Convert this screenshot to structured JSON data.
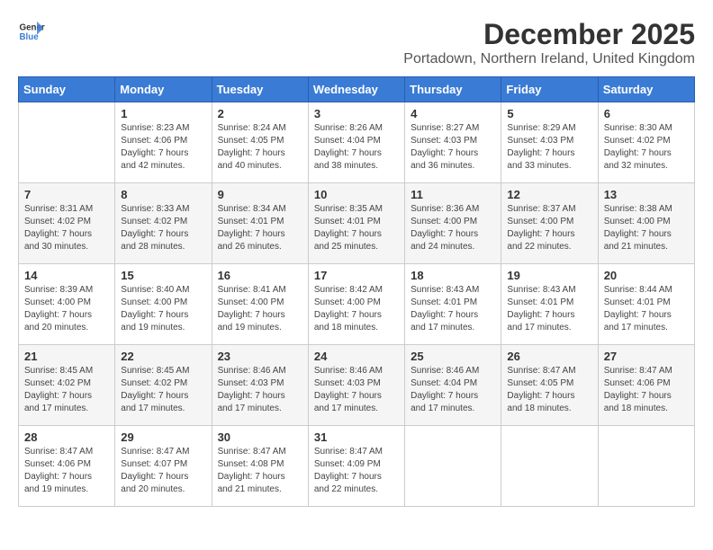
{
  "header": {
    "logo_general": "General",
    "logo_blue": "Blue",
    "month": "December 2025",
    "location": "Portadown, Northern Ireland, United Kingdom"
  },
  "days_of_week": [
    "Sunday",
    "Monday",
    "Tuesday",
    "Wednesday",
    "Thursday",
    "Friday",
    "Saturday"
  ],
  "weeks": [
    [
      {
        "day": "",
        "info": ""
      },
      {
        "day": "1",
        "info": "Sunrise: 8:23 AM\nSunset: 4:06 PM\nDaylight: 7 hours\nand 42 minutes."
      },
      {
        "day": "2",
        "info": "Sunrise: 8:24 AM\nSunset: 4:05 PM\nDaylight: 7 hours\nand 40 minutes."
      },
      {
        "day": "3",
        "info": "Sunrise: 8:26 AM\nSunset: 4:04 PM\nDaylight: 7 hours\nand 38 minutes."
      },
      {
        "day": "4",
        "info": "Sunrise: 8:27 AM\nSunset: 4:03 PM\nDaylight: 7 hours\nand 36 minutes."
      },
      {
        "day": "5",
        "info": "Sunrise: 8:29 AM\nSunset: 4:03 PM\nDaylight: 7 hours\nand 33 minutes."
      },
      {
        "day": "6",
        "info": "Sunrise: 8:30 AM\nSunset: 4:02 PM\nDaylight: 7 hours\nand 32 minutes."
      }
    ],
    [
      {
        "day": "7",
        "info": "Sunrise: 8:31 AM\nSunset: 4:02 PM\nDaylight: 7 hours\nand 30 minutes."
      },
      {
        "day": "8",
        "info": "Sunrise: 8:33 AM\nSunset: 4:02 PM\nDaylight: 7 hours\nand 28 minutes."
      },
      {
        "day": "9",
        "info": "Sunrise: 8:34 AM\nSunset: 4:01 PM\nDaylight: 7 hours\nand 26 minutes."
      },
      {
        "day": "10",
        "info": "Sunrise: 8:35 AM\nSunset: 4:01 PM\nDaylight: 7 hours\nand 25 minutes."
      },
      {
        "day": "11",
        "info": "Sunrise: 8:36 AM\nSunset: 4:00 PM\nDaylight: 7 hours\nand 24 minutes."
      },
      {
        "day": "12",
        "info": "Sunrise: 8:37 AM\nSunset: 4:00 PM\nDaylight: 7 hours\nand 22 minutes."
      },
      {
        "day": "13",
        "info": "Sunrise: 8:38 AM\nSunset: 4:00 PM\nDaylight: 7 hours\nand 21 minutes."
      }
    ],
    [
      {
        "day": "14",
        "info": "Sunrise: 8:39 AM\nSunset: 4:00 PM\nDaylight: 7 hours\nand 20 minutes."
      },
      {
        "day": "15",
        "info": "Sunrise: 8:40 AM\nSunset: 4:00 PM\nDaylight: 7 hours\nand 19 minutes."
      },
      {
        "day": "16",
        "info": "Sunrise: 8:41 AM\nSunset: 4:00 PM\nDaylight: 7 hours\nand 19 minutes."
      },
      {
        "day": "17",
        "info": "Sunrise: 8:42 AM\nSunset: 4:00 PM\nDaylight: 7 hours\nand 18 minutes."
      },
      {
        "day": "18",
        "info": "Sunrise: 8:43 AM\nSunset: 4:01 PM\nDaylight: 7 hours\nand 17 minutes."
      },
      {
        "day": "19",
        "info": "Sunrise: 8:43 AM\nSunset: 4:01 PM\nDaylight: 7 hours\nand 17 minutes."
      },
      {
        "day": "20",
        "info": "Sunrise: 8:44 AM\nSunset: 4:01 PM\nDaylight: 7 hours\nand 17 minutes."
      }
    ],
    [
      {
        "day": "21",
        "info": "Sunrise: 8:45 AM\nSunset: 4:02 PM\nDaylight: 7 hours\nand 17 minutes."
      },
      {
        "day": "22",
        "info": "Sunrise: 8:45 AM\nSunset: 4:02 PM\nDaylight: 7 hours\nand 17 minutes."
      },
      {
        "day": "23",
        "info": "Sunrise: 8:46 AM\nSunset: 4:03 PM\nDaylight: 7 hours\nand 17 minutes."
      },
      {
        "day": "24",
        "info": "Sunrise: 8:46 AM\nSunset: 4:03 PM\nDaylight: 7 hours\nand 17 minutes."
      },
      {
        "day": "25",
        "info": "Sunrise: 8:46 AM\nSunset: 4:04 PM\nDaylight: 7 hours\nand 17 minutes."
      },
      {
        "day": "26",
        "info": "Sunrise: 8:47 AM\nSunset: 4:05 PM\nDaylight: 7 hours\nand 18 minutes."
      },
      {
        "day": "27",
        "info": "Sunrise: 8:47 AM\nSunset: 4:06 PM\nDaylight: 7 hours\nand 18 minutes."
      }
    ],
    [
      {
        "day": "28",
        "info": "Sunrise: 8:47 AM\nSunset: 4:06 PM\nDaylight: 7 hours\nand 19 minutes."
      },
      {
        "day": "29",
        "info": "Sunrise: 8:47 AM\nSunset: 4:07 PM\nDaylight: 7 hours\nand 20 minutes."
      },
      {
        "day": "30",
        "info": "Sunrise: 8:47 AM\nSunset: 4:08 PM\nDaylight: 7 hours\nand 21 minutes."
      },
      {
        "day": "31",
        "info": "Sunrise: 8:47 AM\nSunset: 4:09 PM\nDaylight: 7 hours\nand 22 minutes."
      },
      {
        "day": "",
        "info": ""
      },
      {
        "day": "",
        "info": ""
      },
      {
        "day": "",
        "info": ""
      }
    ]
  ]
}
